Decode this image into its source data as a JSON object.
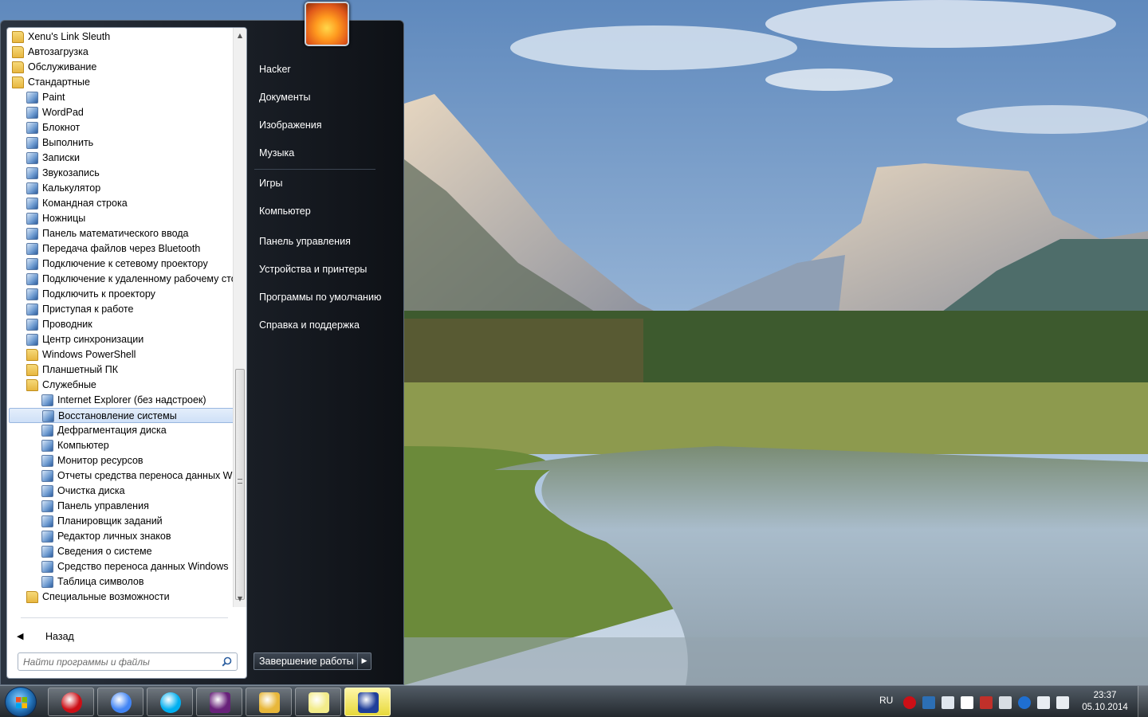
{
  "start_menu": {
    "programs": [
      {
        "label": "Xenu's Link Sleuth",
        "icon": "folder-icon",
        "indent": 0
      },
      {
        "label": "Автозагрузка",
        "icon": "folder-icon",
        "indent": 0
      },
      {
        "label": "Обслуживание",
        "icon": "folder-icon",
        "indent": 0
      },
      {
        "label": "Стандартные",
        "icon": "folder-open-icon",
        "indent": 0
      },
      {
        "label": "Paint",
        "icon": "paint-icon",
        "indent": 1
      },
      {
        "label": "WordPad",
        "icon": "wordpad-icon",
        "indent": 1
      },
      {
        "label": "Блокнот",
        "icon": "notepad-icon",
        "indent": 1
      },
      {
        "label": "Выполнить",
        "icon": "run-icon",
        "indent": 1
      },
      {
        "label": "Записки",
        "icon": "sticky-notes-icon",
        "indent": 1
      },
      {
        "label": "Звукозапись",
        "icon": "microphone-icon",
        "indent": 1
      },
      {
        "label": "Калькулятор",
        "icon": "calculator-icon",
        "indent": 1
      },
      {
        "label": "Командная строка",
        "icon": "command-prompt-icon",
        "indent": 1
      },
      {
        "label": "Ножницы",
        "icon": "scissors-icon",
        "indent": 1
      },
      {
        "label": "Панель математического ввода",
        "icon": "math-input-icon",
        "indent": 1
      },
      {
        "label": "Передача файлов через Bluetooth",
        "icon": "bluetooth-icon",
        "indent": 1
      },
      {
        "label": "Подключение к сетевому проектору",
        "icon": "network-projector-icon",
        "indent": 1
      },
      {
        "label": "Подключение к удаленному рабочему столу",
        "icon": "remote-desktop-icon",
        "indent": 1
      },
      {
        "label": "Подключить к проектору",
        "icon": "projector-icon",
        "indent": 1
      },
      {
        "label": "Приступая к работе",
        "icon": "getting-started-icon",
        "indent": 1
      },
      {
        "label": "Проводник",
        "icon": "explorer-icon",
        "indent": 1
      },
      {
        "label": "Центр синхронизации",
        "icon": "sync-center-icon",
        "indent": 1
      },
      {
        "label": "Windows PowerShell",
        "icon": "folder-icon",
        "indent": 1
      },
      {
        "label": "Планшетный ПК",
        "icon": "folder-icon",
        "indent": 1
      },
      {
        "label": "Служебные",
        "icon": "folder-open-icon",
        "indent": 1
      },
      {
        "label": "Internet Explorer (без надстроек)",
        "icon": "internet-explorer-icon",
        "indent": 2
      },
      {
        "label": "Восстановление системы",
        "icon": "system-restore-icon",
        "indent": 2,
        "selected": true
      },
      {
        "label": "Дефрагментация диска",
        "icon": "defrag-icon",
        "indent": 2
      },
      {
        "label": "Компьютер",
        "icon": "computer-icon",
        "indent": 2
      },
      {
        "label": "Монитор ресурсов",
        "icon": "resource-monitor-icon",
        "indent": 2
      },
      {
        "label": "Отчеты средства переноса данных Windows",
        "icon": "transfer-reports-icon",
        "indent": 2
      },
      {
        "label": "Очистка диска",
        "icon": "disk-cleanup-icon",
        "indent": 2
      },
      {
        "label": "Панель управления",
        "icon": "control-panel-icon",
        "indent": 2
      },
      {
        "label": "Планировщик заданий",
        "icon": "task-scheduler-icon",
        "indent": 2
      },
      {
        "label": "Редактор личных знаков",
        "icon": "char-editor-icon",
        "indent": 2
      },
      {
        "label": "Сведения о системе",
        "icon": "system-info-icon",
        "indent": 2
      },
      {
        "label": "Средство переноса данных Windows",
        "icon": "easy-transfer-icon",
        "indent": 2
      },
      {
        "label": "Таблица символов",
        "icon": "character-map-icon",
        "indent": 2
      },
      {
        "label": "Специальные возможности",
        "icon": "folder-icon",
        "indent": 1
      }
    ],
    "back_label": "Назад",
    "search_placeholder": "Найти программы и файлы",
    "right_items": [
      {
        "label": "Hacker"
      },
      {
        "label": "Документы"
      },
      {
        "label": "Изображения"
      },
      {
        "label": "Музыка"
      },
      {
        "label": "Игры"
      },
      {
        "label": "Компьютер"
      },
      {
        "label": "Панель управления"
      },
      {
        "label": "Устройства и принтеры"
      },
      {
        "label": "Программы по умолчанию"
      },
      {
        "label": "Справка и поддержка"
      }
    ],
    "shutdown_label": "Завершение работы"
  },
  "taskbar": {
    "pinned": [
      {
        "name": "opera",
        "icon": "opera-icon",
        "color": "#cc0f16"
      },
      {
        "name": "chrome",
        "icon": "chrome-icon",
        "color": "#4285f4"
      },
      {
        "name": "skype",
        "icon": "skype-icon",
        "color": "#00aff0"
      },
      {
        "name": "visual-studio",
        "icon": "visual-studio-icon",
        "color": "#68217a"
      },
      {
        "name": "file-manager",
        "icon": "file-manager-icon",
        "color": "#e8b73a"
      },
      {
        "name": "sticky-notes",
        "icon": "sticky-notes-icon",
        "color": "#f3ec8a"
      },
      {
        "name": "media-player",
        "icon": "media-player-icon",
        "color": "#1f3f9a",
        "active": true
      }
    ],
    "language": "RU",
    "tray_icons": [
      "opera-tray-icon",
      "ffx-icon",
      "window-icon",
      "lav-video-icon",
      "lav-audio-icon",
      "network-icon",
      "update-icon",
      "flag-icon",
      "volume-icon"
    ],
    "time": "23:37",
    "date": "05.10.2014"
  }
}
